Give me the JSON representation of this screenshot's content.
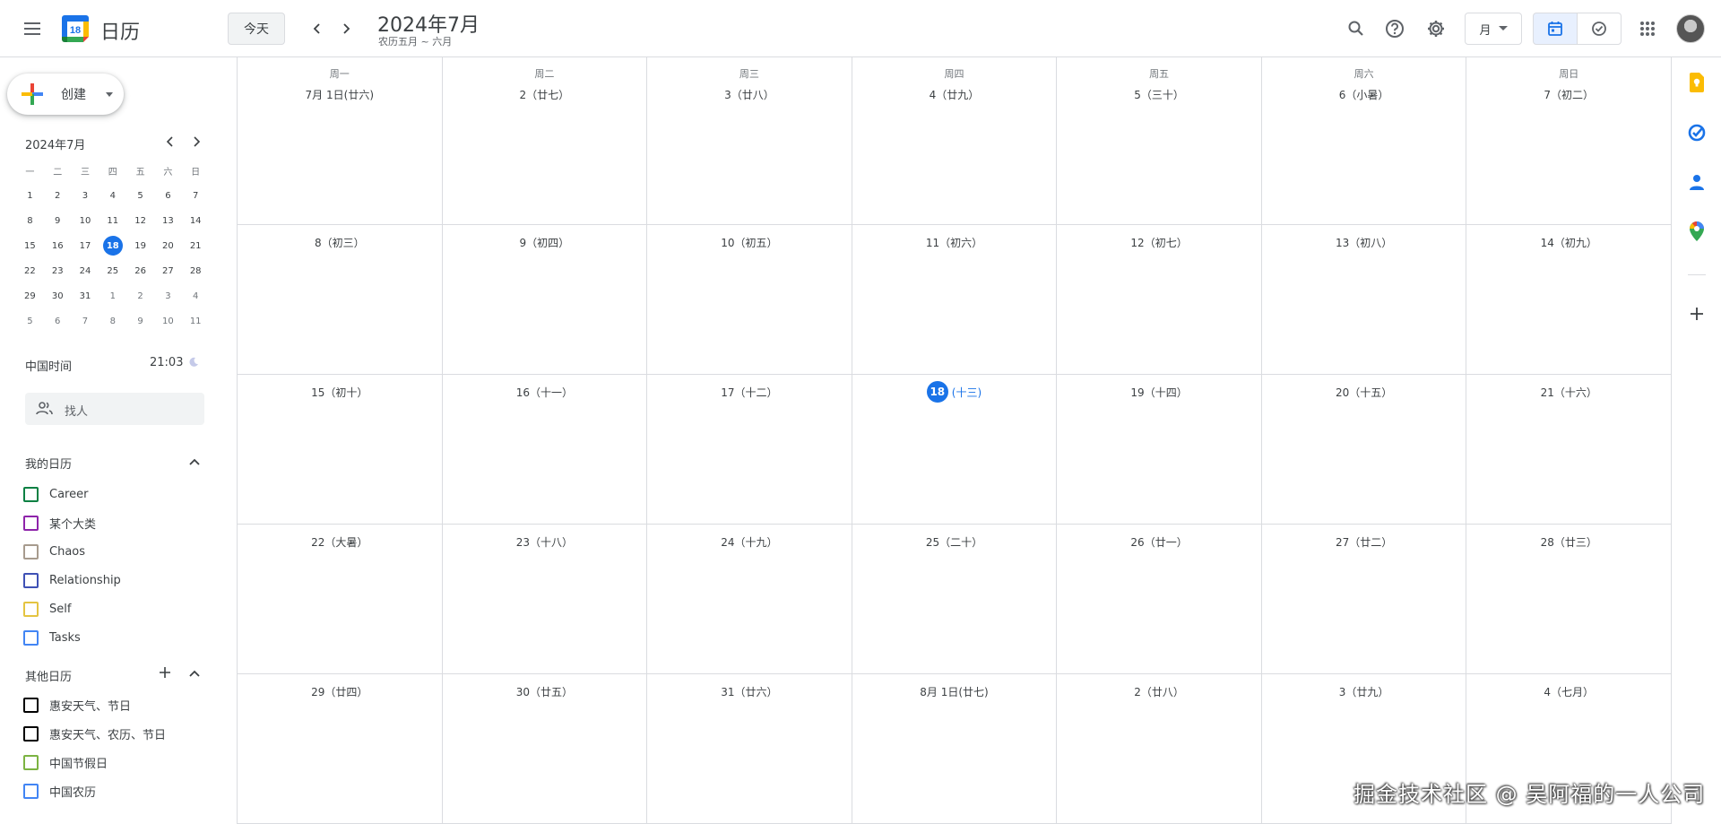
{
  "header": {
    "app_title": "日历",
    "logo_day": "18",
    "today_label": "今天",
    "title": "2024年7月",
    "subtitle": "农历五月 ~ 六月",
    "view_label": "月"
  },
  "sidebar": {
    "create_label": "创建",
    "mini_cal": {
      "title": "2024年7月",
      "dow": [
        "一",
        "二",
        "三",
        "四",
        "五",
        "六",
        "日"
      ],
      "weeks": [
        [
          "1",
          "2",
          "3",
          "4",
          "5",
          "6",
          "7"
        ],
        [
          "8",
          "9",
          "10",
          "11",
          "12",
          "13",
          "14"
        ],
        [
          "15",
          "16",
          "17",
          "18",
          "19",
          "20",
          "21"
        ],
        [
          "22",
          "23",
          "24",
          "25",
          "26",
          "27",
          "28"
        ],
        [
          "29",
          "30",
          "31",
          "1",
          "2",
          "3",
          "4"
        ],
        [
          "5",
          "6",
          "7",
          "8",
          "9",
          "10",
          "11"
        ]
      ],
      "selected": "18"
    },
    "timezone": {
      "label": "中国时间",
      "time": "21:03"
    },
    "search_people_placeholder": "找人",
    "my_calendars": {
      "title": "我的日历",
      "items": [
        {
          "name": "Career",
          "color": "#0b8043"
        },
        {
          "name": "某个大类",
          "color": "#8e24aa"
        },
        {
          "name": "Chaos",
          "color": "#a79b8e"
        },
        {
          "name": "Relationship",
          "color": "#3f51b5"
        },
        {
          "name": "Self",
          "color": "#e4c441"
        },
        {
          "name": "Tasks",
          "color": "#4285f4"
        }
      ]
    },
    "other_calendars": {
      "title": "其他日历",
      "items": [
        {
          "name": "惠安天气、节日",
          "color": "#000000"
        },
        {
          "name": "惠安天气、农历、节日",
          "color": "#000000"
        },
        {
          "name": "中国节假日",
          "color": "#7cb342"
        },
        {
          "name": "中国农历",
          "color": "#4285f4"
        }
      ]
    }
  },
  "month": {
    "dow": [
      "周一",
      "周二",
      "周三",
      "周四",
      "周五",
      "周六",
      "周日"
    ],
    "weeks": [
      [
        {
          "label": "7月 1日(廿六)"
        },
        {
          "label": "2（廿七）"
        },
        {
          "label": "3（廿八）"
        },
        {
          "label": "4（廿九）"
        },
        {
          "label": "5（三十）"
        },
        {
          "label": "6（小暑）"
        },
        {
          "label": "7（初二）"
        }
      ],
      [
        {
          "label": "8（初三）"
        },
        {
          "label": "9（初四）"
        },
        {
          "label": "10（初五）"
        },
        {
          "label": "11（初六）"
        },
        {
          "label": "12（初七）"
        },
        {
          "label": "13（初八）"
        },
        {
          "label": "14（初九）"
        }
      ],
      [
        {
          "label": "15（初十）"
        },
        {
          "label": "16（十一）"
        },
        {
          "label": "17（十二）"
        },
        {
          "num": "18",
          "label": "(十三)",
          "today": true
        },
        {
          "label": "19（十四）"
        },
        {
          "label": "20（十五）"
        },
        {
          "label": "21（十六）"
        }
      ],
      [
        {
          "label": "22（大暑）"
        },
        {
          "label": "23（十八）"
        },
        {
          "label": "24（十九）"
        },
        {
          "label": "25（二十）"
        },
        {
          "label": "26（廿一）"
        },
        {
          "label": "27（廿二）"
        },
        {
          "label": "28（廿三）"
        }
      ],
      [
        {
          "label": "29（廿四）"
        },
        {
          "label": "30（廿五）"
        },
        {
          "label": "31（廿六）"
        },
        {
          "label": "8月 1日(廿七)"
        },
        {
          "label": "2（廿八）"
        },
        {
          "label": "3（廿九）"
        },
        {
          "label": "4（七月）"
        }
      ]
    ]
  },
  "watermark": "掘金技术社区 @ 吴阿福的一人公司"
}
